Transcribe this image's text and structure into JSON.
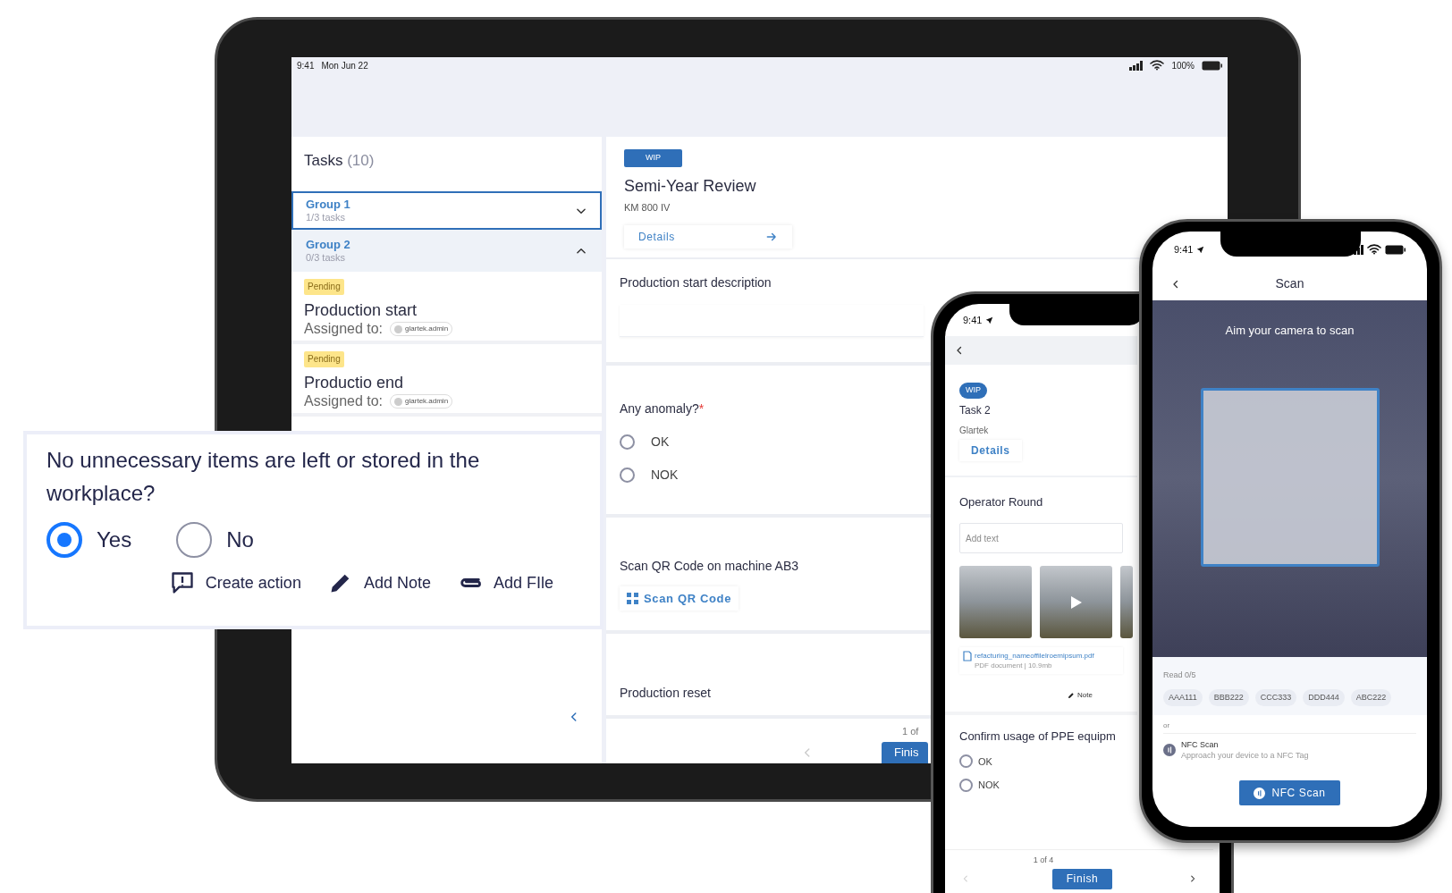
{
  "tablet": {
    "status_bar": {
      "time": "9:41",
      "date": "Mon Jun 22",
      "battery": "100%"
    },
    "tasks_panel": {
      "title": "Tasks",
      "count": "(10)",
      "groups": [
        {
          "name": "Group 1",
          "progress": "1/3 tasks",
          "selected": true,
          "expanded": false
        },
        {
          "name": "Group 2",
          "progress": "0/3 tasks",
          "selected": false,
          "expanded": true,
          "tasks": [
            {
              "status": "Pending",
              "title": "Production start",
              "assigned_label": "Assigned to:",
              "assignee": "glartek.admin"
            },
            {
              "status": "Pending",
              "title": "Productio end",
              "assigned_label": "Assigned to:",
              "assignee": "glartek.admin"
            }
          ]
        }
      ]
    },
    "detail": {
      "badge": "WIP",
      "title": "Semi-Year Review",
      "subtitle": "KM 800 IV",
      "details_button": "Details",
      "fields": [
        {
          "kind": "text",
          "label": "Production start description"
        },
        {
          "kind": "radio",
          "label": "Any anomaly?",
          "required_mark": "*",
          "options": [
            {
              "label": "OK",
              "selected": false
            },
            {
              "label": "NOK",
              "selected": false
            }
          ]
        },
        {
          "kind": "scan",
          "label": "Scan QR Code on machine AB3",
          "button": "Scan QR Code"
        },
        {
          "kind": "label",
          "label": "Production reset"
        }
      ],
      "footer": {
        "page": "1 of",
        "finish_button": "Finis"
      }
    }
  },
  "question_card": {
    "question": "No unnecessary items are left or stored in the workplace?",
    "options": [
      {
        "label": "Yes",
        "selected": true
      },
      {
        "label": "No",
        "selected": false
      }
    ],
    "actions": [
      {
        "kind": "action",
        "label": "Create action"
      },
      {
        "kind": "note",
        "label": "Add Note"
      },
      {
        "kind": "file",
        "label": "Add FIle"
      }
    ]
  },
  "phone_task": {
    "status_bar": {
      "time": "9:41"
    },
    "badge": "WIP",
    "title": "Task 2",
    "subtitle": "Glartek",
    "details_button": "Details",
    "operator_round": {
      "label": "Operator Round",
      "placeholder": "Add text",
      "media": [
        {
          "kind": "photo"
        },
        {
          "kind": "video"
        },
        {
          "kind": "photo"
        }
      ],
      "file": {
        "name": "refacturing_nameoffilelroemipsum.pdf",
        "meta": "PDF document | 10.9mb"
      },
      "note_button": "Note"
    },
    "confirm": {
      "label": "Confirm usage of PPE equipm",
      "options": [
        {
          "label": "OK",
          "selected": false
        },
        {
          "label": "NOK",
          "selected": false
        }
      ]
    },
    "footer": {
      "page": "1 of 4",
      "finish_button": "Finish"
    }
  },
  "phone_scan": {
    "status_bar": {
      "time": "9:41"
    },
    "title": "Scan",
    "hint": "Aim your camera to scan",
    "read_count": "Read 0/5",
    "codes": [
      "AAA111",
      "BBB222",
      "CCC333",
      "DDD444",
      "ABC222"
    ],
    "separator": "or",
    "nfc": {
      "title": "NFC Scan",
      "description": "Approach your device to a NFC Tag"
    },
    "nfc_button": "NFC Scan"
  }
}
